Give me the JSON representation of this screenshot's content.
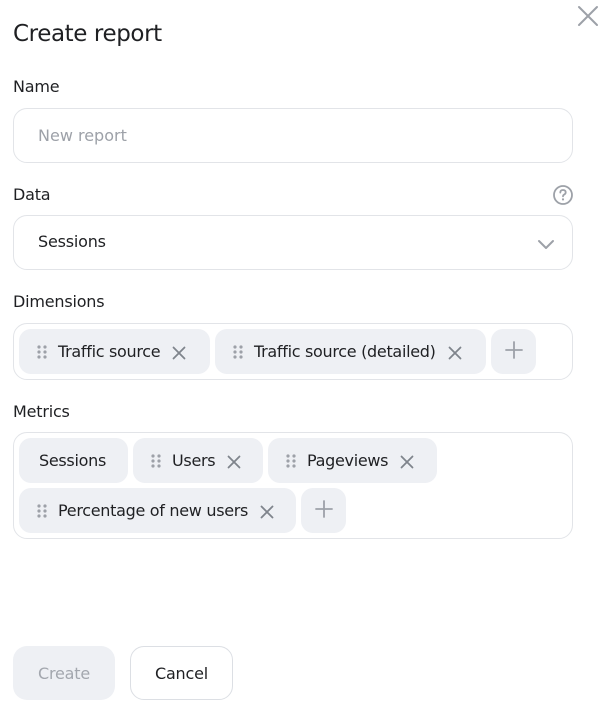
{
  "dialog": {
    "title": "Create report",
    "name_label": "Name",
    "name_placeholder": "New report",
    "name_value": "",
    "data_label": "Data",
    "data_value": "Sessions",
    "dimensions_label": "Dimensions",
    "dimensions": [
      "Traffic source",
      "Traffic source (detailed)"
    ],
    "metrics_label": "Metrics",
    "metrics": [
      "Sessions",
      "Users",
      "Pageviews",
      "Percentage of new users"
    ],
    "create_label": "Create",
    "cancel_label": "Cancel"
  },
  "icons": {
    "close": "close-icon",
    "help": "question-circle-icon",
    "dropdown": "chevron-down-icon",
    "drag": "drag-handle-icon",
    "remove": "remove-x-icon",
    "add": "plus-icon"
  },
  "colors": {
    "chip_background": "#eef0f4",
    "border": "#e2e4e8",
    "icon_gray": "#9da1a8",
    "disabled_text": "#a3a7ae"
  }
}
